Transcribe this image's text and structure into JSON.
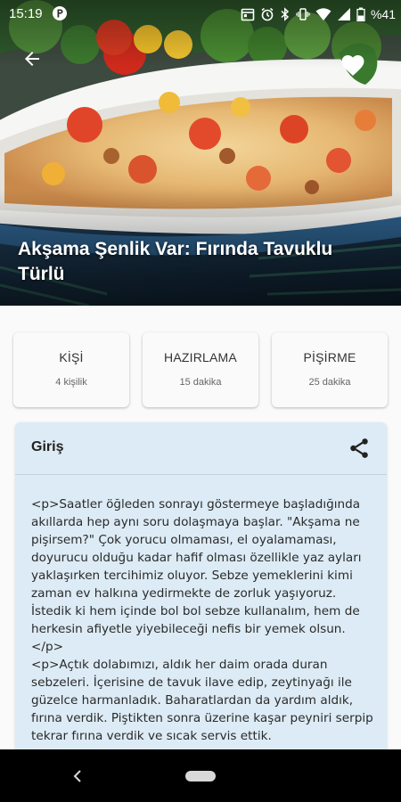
{
  "status_bar": {
    "time": "15:19",
    "battery_percent": "%41",
    "icons": [
      "p-app-icon",
      "calendar-icon",
      "alarm-icon",
      "bluetooth-icon",
      "vibrate-icon",
      "wifi-icon",
      "signal-icon",
      "battery-icon"
    ]
  },
  "header": {
    "back_icon": "arrow-left-icon",
    "favorite_icon": "heart-icon",
    "title": "Akşama Şenlik Var: Fırında Tavuklu Türlü"
  },
  "info_cards": [
    {
      "label": "KİŞİ",
      "value": "4 kişilik"
    },
    {
      "label": "HAZIRLAMA",
      "value": "15 dakika"
    },
    {
      "label": "PİŞİRME",
      "value": "25 dakika"
    }
  ],
  "intro": {
    "title": "Giriş",
    "share_icon": "share-icon",
    "body": "<p>Saatler öğleden sonrayı göstermeye başladığında akıllarda hep aynı soru dolaşmaya başlar. \"Akşama ne pişirsem?\" Çok yorucu olmaması, el oyalamaması, doyurucu olduğu kadar hafif olması özellikle yaz ayları yaklaşırken tercihimiz oluyor. Sebze yemeklerini kimi zaman ev halkına yedirmekte de zorluk yaşıyoruz. İstedik ki hem içinde bol bol sebze kullanalım, hem de herkesin afiyetle yiyebileceği nefis bir yemek olsun.</p>\n<p>Açtık dolabımızı, aldık her daim orada duran sebzeleri. İçerisine de tavuk ilave edip, zeytinyağı ile güzelce harmanladık. Baharatlardan da yardım aldık, fırına verdik. Piştikten sonra üzerine kaşar peyniri serpip tekrar fırına verdik ve sıcak servis ettik."
  },
  "colors": {
    "intro_background": "#dcebf5",
    "navbar": "#000000",
    "title_text": "#ffffff"
  },
  "nav_bar": {
    "back_icon": "nav-back-icon",
    "home_icon": "nav-home-pill-icon"
  }
}
